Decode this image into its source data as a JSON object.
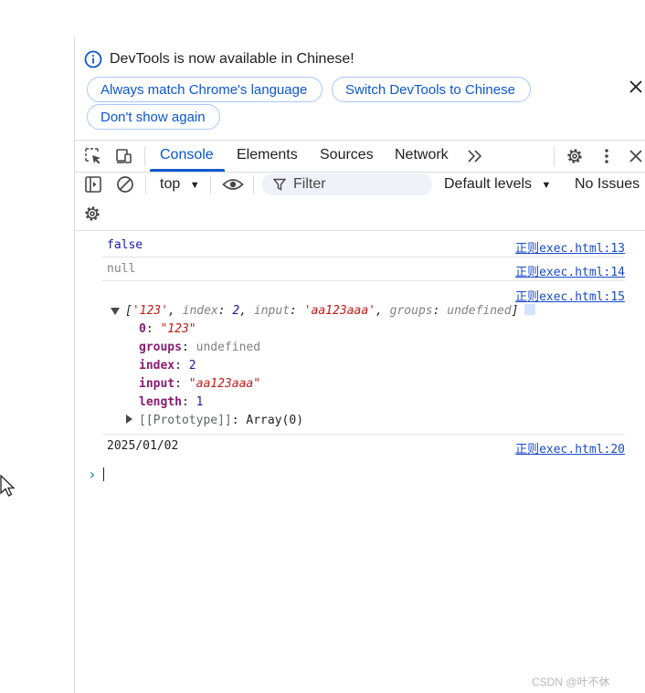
{
  "infobar": {
    "message": "DevTools is now available in Chinese!",
    "buttons": [
      "Always match Chrome's language",
      "Switch DevTools to Chinese",
      "Don't show again"
    ]
  },
  "tabs": [
    {
      "label": "Console",
      "active": true
    },
    {
      "label": "Elements",
      "active": false
    },
    {
      "label": "Sources",
      "active": false
    },
    {
      "label": "Network",
      "active": false
    }
  ],
  "toolbar": {
    "context": "top",
    "filter_placeholder": "Filter",
    "levels": "Default levels",
    "issues": "No Issues"
  },
  "console": {
    "messages": [
      {
        "text": "false",
        "source": "正则exec.html:13"
      },
      {
        "text": "null",
        "source": "正则exec.html:14"
      },
      {
        "text": "",
        "source": "正则exec.html:15"
      }
    ],
    "array_preview": {
      "open": "[",
      "item0": "'123'",
      "index_key": "index",
      "index_val": "2",
      "input_key": "input",
      "input_val": "'aa123aaa'",
      "groups_key": "groups",
      "groups_val": "undefined",
      "close": "]"
    },
    "array_props": [
      {
        "key": "0",
        "value": "\"123\""
      },
      {
        "key": "groups",
        "value": "undefined"
      },
      {
        "key": "index",
        "value": "2"
      },
      {
        "key": "input",
        "value": "\"aa123aaa\""
      },
      {
        "key": "length",
        "value": "1"
      }
    ],
    "prototype": "[[Prototype]]",
    "prototype_value": "Array(0)",
    "date_message": {
      "text": "2025/01/02",
      "source": "正则exec.html:20"
    },
    "prompt_symbol": "›"
  },
  "watermark": "CSDN @叶不休",
  "colors": {
    "accent": "#0b57d0",
    "link": "#1a4ac7",
    "string": "#c41a16",
    "key": "#871d71",
    "number": "#1a1aa6"
  }
}
